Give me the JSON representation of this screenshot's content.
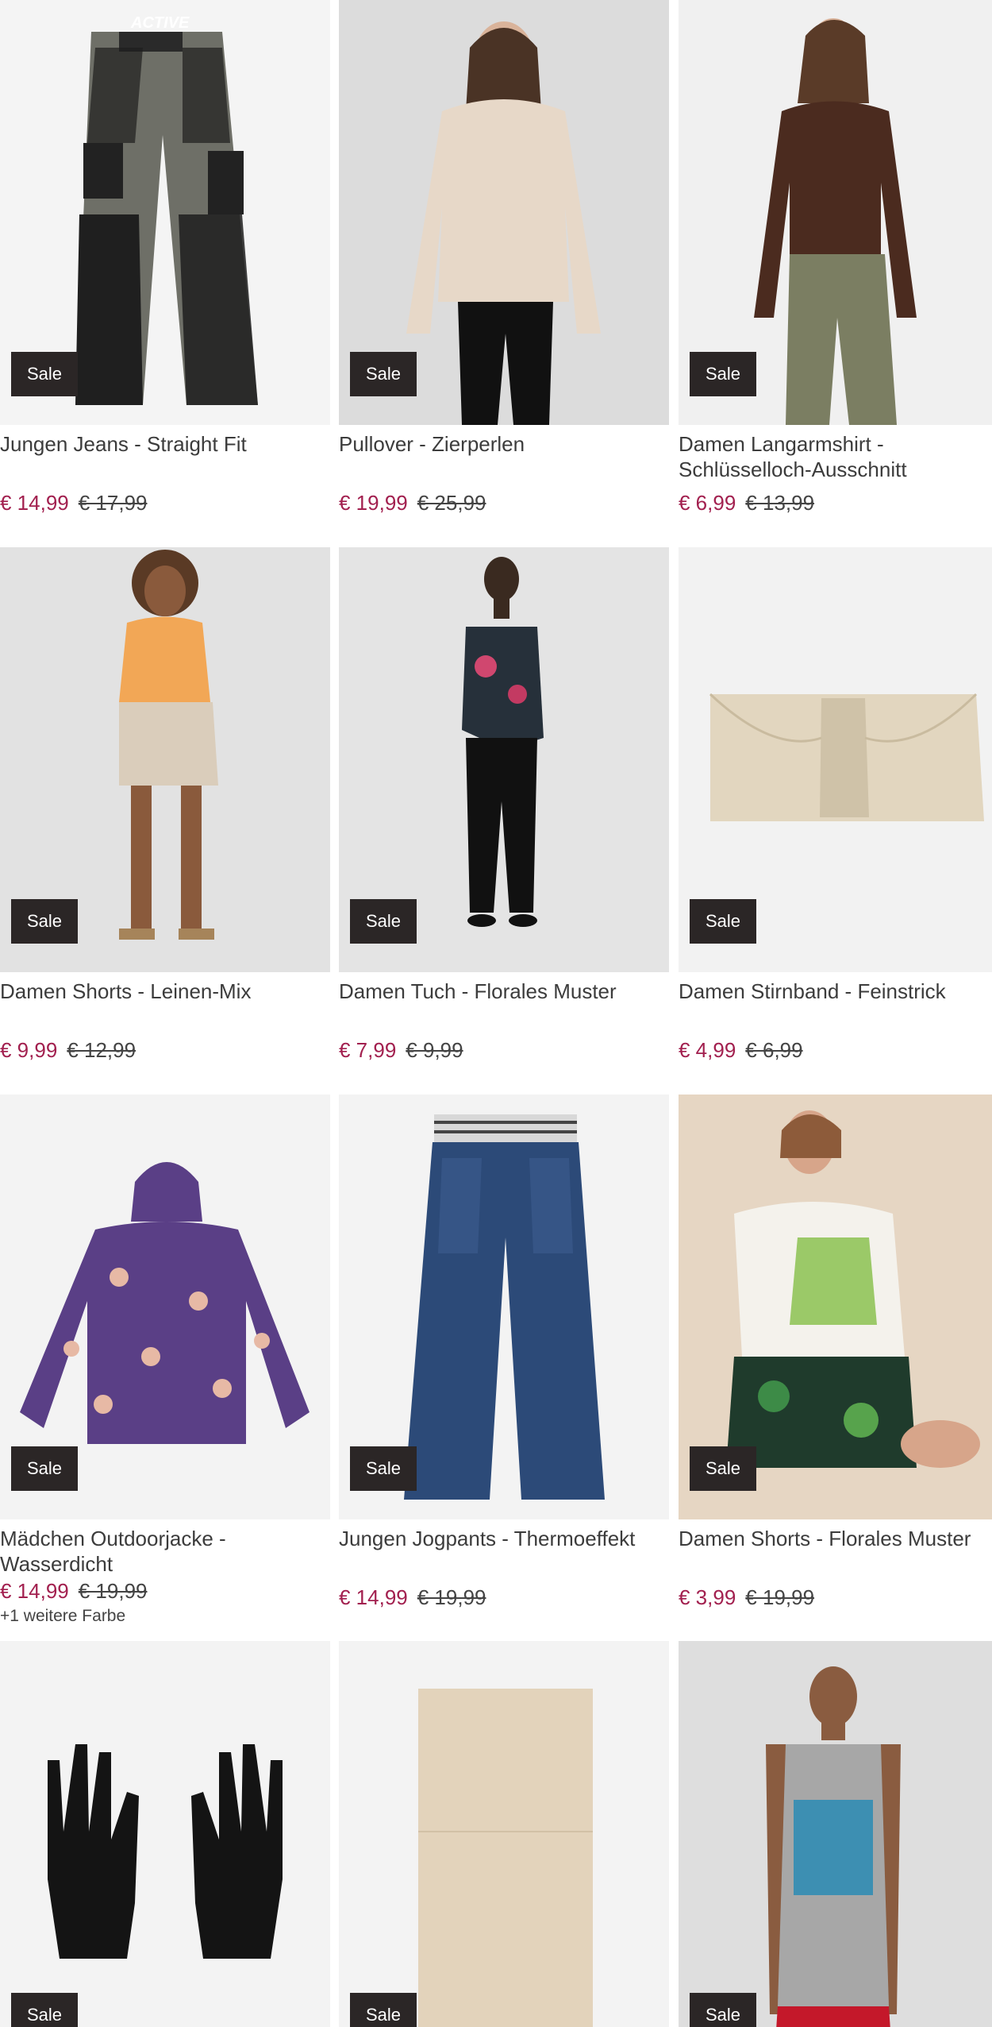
{
  "products": [
    {
      "title": "Jungen Jeans - Straight Fit",
      "badge": "Sale",
      "price_new": "€ 14,99",
      "price_old": "€ 17,99",
      "image_text": "ACTIVE"
    },
    {
      "title": "Pullover - Zierperlen",
      "badge": "Sale",
      "price_new": "€ 19,99",
      "price_old": "€ 25,99"
    },
    {
      "title": "Damen Langarmshirt - Schlüsselloch-Ausschnitt",
      "badge": "Sale",
      "price_new": "€ 6,99",
      "price_old": "€ 13,99"
    },
    {
      "title": "Damen Shorts - Leinen-Mix",
      "badge": "Sale",
      "price_new": "€ 9,99",
      "price_old": "€ 12,99"
    },
    {
      "title": "Damen Tuch - Florales Muster",
      "badge": "Sale",
      "price_new": "€ 7,99",
      "price_old": "€ 9,99"
    },
    {
      "title": "Damen Stirnband - Feinstrick",
      "badge": "Sale",
      "price_new": "€ 4,99",
      "price_old": "€ 6,99"
    },
    {
      "title": "Mädchen Outdoorjacke - Wasserdicht",
      "badge": "Sale",
      "price_new": "€ 14,99",
      "price_old": "€ 19,99",
      "more_colors": "+1 weitere Farbe"
    },
    {
      "title": "Jungen Jogpants - Thermoeffekt",
      "badge": "Sale",
      "price_new": "€ 14,99",
      "price_old": "€ 19,99"
    },
    {
      "title": "Damen Shorts - Florales Muster",
      "badge": "Sale",
      "price_new": "€ 3,99",
      "price_old": "€ 19,99"
    },
    {
      "badge": "Sale"
    },
    {
      "badge": "Sale"
    },
    {
      "badge": "Sale"
    }
  ],
  "colors": {
    "sale_price": "#a2204f",
    "badge_bg": "#2b2626",
    "tile_bg": "#f3f3f3"
  }
}
